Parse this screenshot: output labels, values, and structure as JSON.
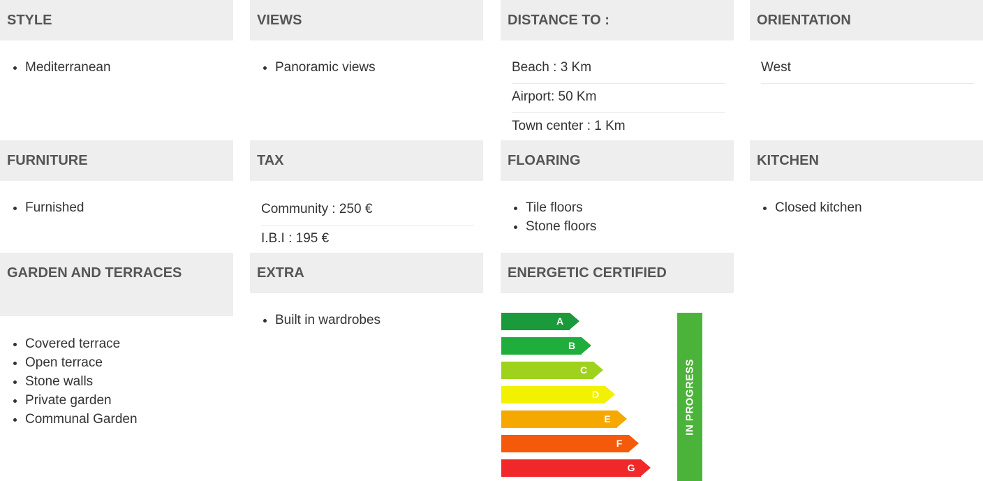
{
  "sections": {
    "style": {
      "title": "STYLE",
      "items": [
        "Mediterranean"
      ]
    },
    "views": {
      "title": "VIEWS",
      "items": [
        "Panoramic views"
      ]
    },
    "distance": {
      "title": "DISTANCE TO :",
      "rows": [
        "Beach : 3 Km",
        "Airport: 50 Km",
        "Town center : 1 Km"
      ]
    },
    "orientation": {
      "title": "ORIENTATION",
      "rows": [
        "West"
      ]
    },
    "furniture": {
      "title": "FURNITURE",
      "items": [
        "Furnished"
      ]
    },
    "tax": {
      "title": "TAX",
      "rows": [
        "Community : 250 €",
        "I.B.I : 195 €"
      ]
    },
    "flooring": {
      "title": "FLOARING",
      "items": [
        "Tile floors",
        "Stone floors"
      ]
    },
    "kitchen": {
      "title": "KITCHEN",
      "items": [
        "Closed kitchen"
      ]
    },
    "garden": {
      "title": "GARDEN AND TERRACES",
      "items": [
        "Covered terrace",
        "Open terrace",
        "Stone walls",
        "Private garden",
        "Communal Garden"
      ]
    },
    "extra": {
      "title": "EXTRA",
      "items": [
        "Built in wardrobes"
      ]
    },
    "energy": {
      "title": "ENERGETIC CERTIFIED",
      "status": "IN PROGRESS",
      "status_color": "#4cb33a",
      "classes": [
        {
          "label": "A",
          "color": "#1a9a3a"
        },
        {
          "label": "B",
          "color": "#1fae3b"
        },
        {
          "label": "C",
          "color": "#9fd21c"
        },
        {
          "label": "D",
          "color": "#f2f200"
        },
        {
          "label": "E",
          "color": "#f5a800"
        },
        {
          "label": "F",
          "color": "#f55a0a"
        },
        {
          "label": "G",
          "color": "#f0282a"
        }
      ]
    }
  }
}
